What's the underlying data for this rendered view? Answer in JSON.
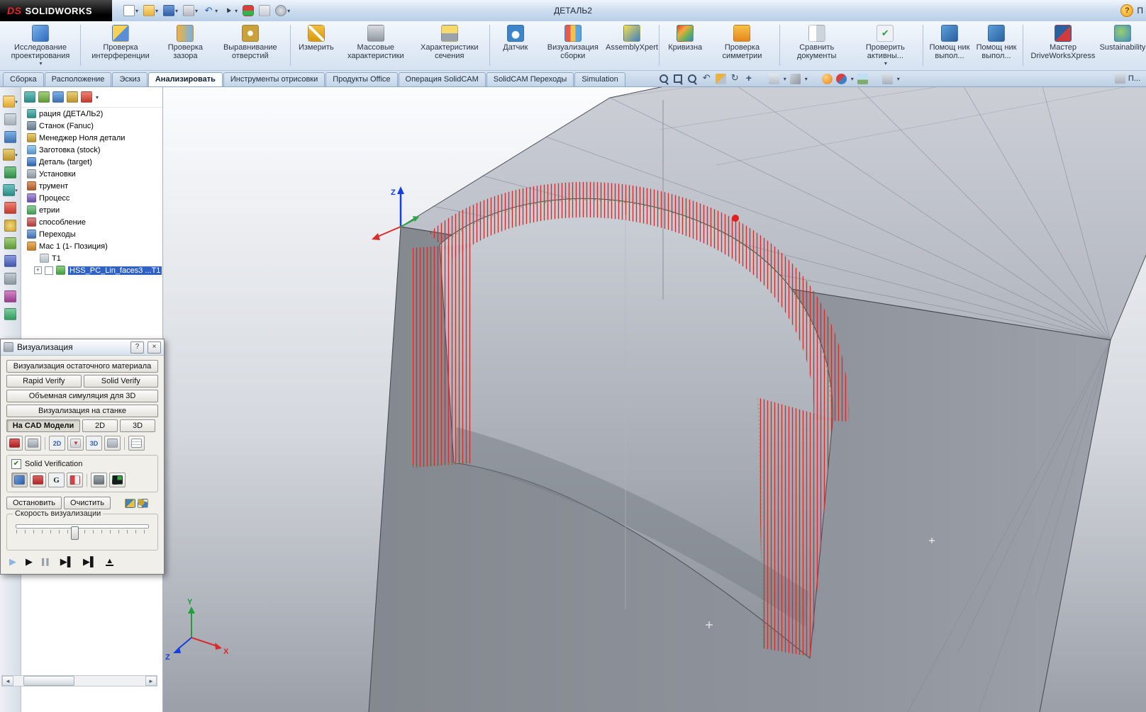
{
  "ui": {
    "dropdown": "▾",
    "scroll_left": "◄",
    "scroll_right": "►",
    "expand": "+"
  },
  "title_bar": {
    "logo": "DS",
    "app_name": "SOLIDWORKS",
    "document_title": "ДЕТАЛЬ2",
    "help": "?",
    "task_pane": "П"
  },
  "quick_access": {
    "icons": [
      "new-document",
      "open",
      "save",
      "print",
      "undo",
      "select",
      "rebuild",
      "properties",
      "options"
    ]
  },
  "ribbon": {
    "buttons": [
      {
        "label": "Исследование проектирования",
        "icon": "design-study"
      },
      {
        "label": "Проверка интерференции",
        "icon": "interference"
      },
      {
        "label": "Проверка зазора",
        "icon": "clearance"
      },
      {
        "label": "Выравнивание отверстий",
        "icon": "hole-alignment"
      },
      {
        "label": "Измерить",
        "icon": "measure"
      },
      {
        "label": "Массовые характеристики",
        "icon": "mass-properties"
      },
      {
        "label": "Характеристики сечения",
        "icon": "section-properties"
      },
      {
        "label": "Датчик",
        "icon": "sensor"
      },
      {
        "label": "Визуализация сборки",
        "icon": "assembly-visualization"
      },
      {
        "label": "AssemblyXpert",
        "icon": "assemblyxpert"
      },
      {
        "label": "Кривизна",
        "icon": "curvature"
      },
      {
        "label": "Проверка симметрии",
        "icon": "symmetry"
      },
      {
        "label": "Сравнить документы",
        "icon": "compare-documents"
      },
      {
        "label": "Проверить активны...",
        "icon": "check-active"
      },
      {
        "label": "Помощ ник выпол...",
        "icon": "task-helper"
      },
      {
        "label": "Помощ ник выпол...",
        "icon": "task-helper"
      },
      {
        "label": "Мастер DriveWorksXpress",
        "icon": "driveworks"
      },
      {
        "label": "Sustainability",
        "icon": "sustainability"
      }
    ]
  },
  "tabs": {
    "items": [
      {
        "label": "Сборка"
      },
      {
        "label": "Расположение"
      },
      {
        "label": "Эскиз"
      },
      {
        "label": "Анализировать"
      },
      {
        "label": "Инструменты отрисовки"
      },
      {
        "label": "Продукты Office"
      },
      {
        "label": "Операция SolidCAM"
      },
      {
        "label": "SolidCAM Переходы"
      },
      {
        "label": "Simulation"
      }
    ],
    "active_index": 3,
    "task_pane": "П..."
  },
  "view_toolbar": {
    "icons": [
      "zoom-fit",
      "zoom-area",
      "zoom-in",
      "previous-view",
      "section-view",
      "rotate-view",
      "pan",
      "view-orientation",
      "display-style",
      "realview",
      "appearances",
      "scene",
      "view-settings"
    ]
  },
  "left_strip": {
    "icons": [
      "open-folder",
      "attachments",
      "design-binder",
      "preview",
      "process",
      "machine",
      "tools",
      "settings-gear",
      "stock",
      "sync",
      "utilities",
      "fixtures",
      "analysis"
    ]
  },
  "feature_tree": {
    "toolbar_icons": [
      "featuremanager-tab",
      "propertymanager-tab",
      "configuration-tab",
      "dimxpert-tab",
      "display-tab"
    ],
    "items": [
      {
        "label": "рация (ДЕТАЛЬ2)",
        "icon": "operation"
      },
      {
        "label": "Станок (Fanuc)",
        "icon": "machine-node"
      },
      {
        "label": "Менеджер Ноля детали",
        "icon": "zero-manager"
      },
      {
        "label": "Заготовка (stock)",
        "icon": "stock-node"
      },
      {
        "label": "Деталь (target)",
        "icon": "target-node"
      },
      {
        "label": "Установки",
        "icon": "setup"
      },
      {
        "label": "трумент",
        "icon": "tool-node"
      },
      {
        "label": "Процесс",
        "icon": "process-node"
      },
      {
        "label": "етрии",
        "icon": "geometry"
      },
      {
        "label": "способление",
        "icon": "fixture-node"
      },
      {
        "label": "Переходы",
        "icon": "transitions"
      },
      {
        "label": "Мас 1 (1- Позиция)",
        "icon": "position"
      },
      {
        "label": "T1",
        "icon": "tool-item"
      },
      {
        "label": "HSS_PC_Lin_faces3 ...T1",
        "icon": "tool-green",
        "selected": true
      }
    ]
  },
  "dialog": {
    "title": "Визуализация",
    "help": "?",
    "close": "×",
    "buttons": {
      "residual": "Визуализация остаточного материала",
      "rapid": "Rapid Verify",
      "solid": "Solid Verify",
      "volume": "Объемная симуляция для 3D",
      "machine": "Визуализация на станке",
      "stop": "Остановить",
      "clear": "Очистить"
    },
    "mode_tabs": [
      {
        "label": "На CAD Модели"
      },
      {
        "label": "2D"
      },
      {
        "label": "3D"
      }
    ],
    "icon_row_a": [
      {
        "icon": "stock-red",
        "glyph": ""
      },
      {
        "icon": "stock-gray",
        "glyph": ""
      },
      {
        "icon": "show-2d",
        "glyph": "2D"
      },
      {
        "icon": "tool-holder",
        "glyph": ""
      },
      {
        "icon": "show-3d",
        "glyph": "3D"
      },
      {
        "icon": "print-small",
        "glyph": ""
      },
      {
        "icon": "data-table",
        "glyph": ""
      }
    ],
    "checkbox": {
      "label": "Solid Verification",
      "checked": true
    },
    "icon_row_b": [
      {
        "icon": "verify-target",
        "glyph": ""
      },
      {
        "icon": "tool-red",
        "glyph": ""
      },
      {
        "icon": "gouge",
        "glyph": "G"
      },
      {
        "icon": "compare-stock",
        "glyph": ""
      },
      {
        "icon": "single-view",
        "glyph": ""
      },
      {
        "icon": "quad-view",
        "glyph": ""
      }
    ],
    "post_icons": [
      "color-swatch",
      "gears"
    ],
    "speed_label": "Скорость визуализации",
    "playback": [
      {
        "icon": "play-from-start",
        "glyph": "▶"
      },
      {
        "icon": "play",
        "glyph": "▶"
      },
      {
        "icon": "pause",
        "glyph": "▌▌"
      },
      {
        "icon": "play-to-end",
        "glyph": "▶▌"
      },
      {
        "icon": "step-forward",
        "glyph": "▶▌"
      },
      {
        "icon": "eject",
        "glyph": "▲"
      }
    ]
  },
  "viewport": {
    "axes": {
      "x": "X",
      "y": "Y",
      "z": "Z"
    }
  }
}
